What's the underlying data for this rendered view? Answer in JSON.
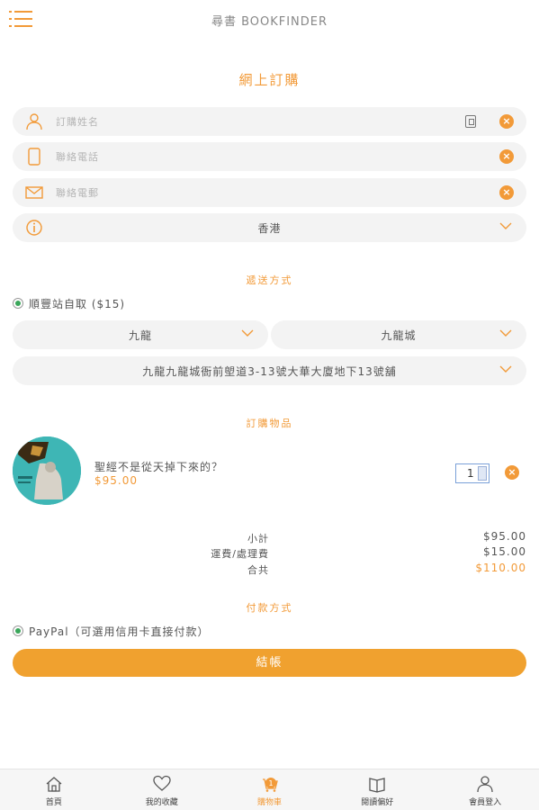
{
  "header": {
    "title": "尋書 BOOKFINDER",
    "menu_icon": "hamburger-menu-icon"
  },
  "page": {
    "title": "網上訂購"
  },
  "form": {
    "name_placeholder": "訂購姓名",
    "phone_placeholder": "聯絡電話",
    "email_placeholder": "聯絡電郵",
    "region_value": "香港"
  },
  "delivery": {
    "section_label": "遞送方式",
    "option_label": "順豐站自取 ($15)",
    "district_value": "九龍",
    "area_value": "九龍城",
    "address_value": "九龍九龍城衙前塱道3-13號大華大廈地下13號舖"
  },
  "order": {
    "section_label": "訂購物品",
    "item_title": "聖經不是從天掉下來的？",
    "item_price": "$95.00",
    "item_qty": "1"
  },
  "summary": {
    "subtotal_label": "小計",
    "subtotal_value": "$95.00",
    "shipping_label": "運費/處理費",
    "shipping_value": "$15.00",
    "total_label": "合共",
    "total_value": "$110.00"
  },
  "payment": {
    "section_label": "付款方式",
    "option_label": "PayPal（可選用信用卡直接付款）",
    "checkout_label": "結帳"
  },
  "tabs": [
    {
      "label": "首頁",
      "icon": "home-icon"
    },
    {
      "label": "我的收藏",
      "icon": "heart-icon"
    },
    {
      "label": "購物車",
      "icon": "cart-icon",
      "badge": "1",
      "active": true
    },
    {
      "label": "閱讀偏好",
      "icon": "book-icon"
    },
    {
      "label": "會員登入",
      "icon": "user-icon"
    }
  ],
  "colors": {
    "accent": "#f29a38",
    "field_bg": "#f3f3f3",
    "radio_selected": "#3aa65a"
  }
}
